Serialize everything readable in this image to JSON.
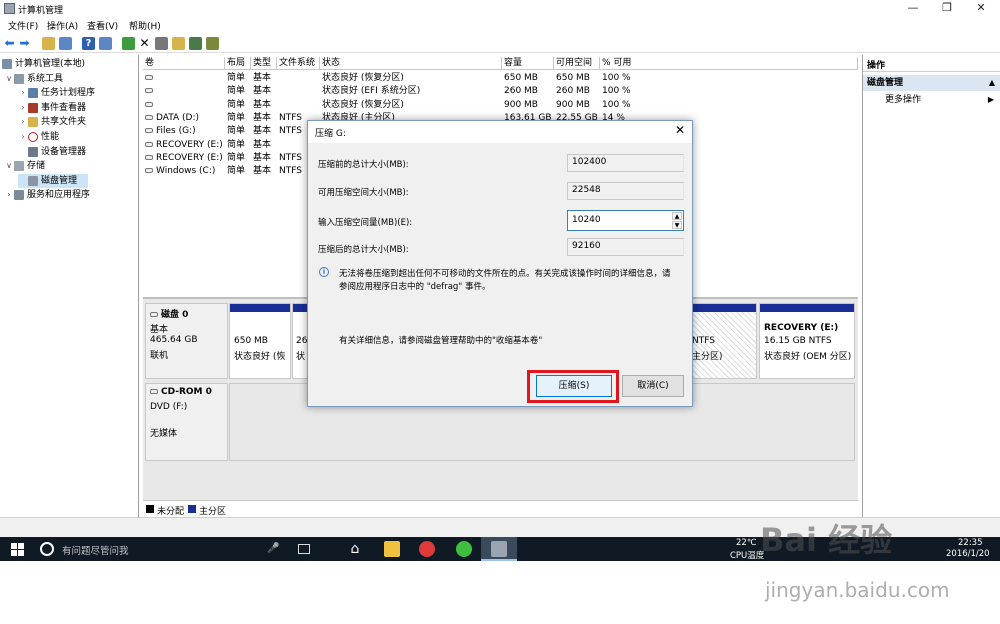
{
  "window": {
    "title": "计算机管理"
  },
  "menu": [
    "文件(F)",
    "操作(A)",
    "查看(V)",
    "帮助(H)"
  ],
  "tree": {
    "root": "计算机管理(本地)",
    "system_tools": "系统工具",
    "task_scheduler": "任务计划程序",
    "event_viewer": "事件查看器",
    "shared_folders": "共享文件夹",
    "performance": "性能",
    "device_manager": "设备管理器",
    "storage": "存储",
    "disk_management": "磁盘管理",
    "services_apps": "服务和应用程序"
  },
  "volume_table": {
    "headers": [
      "卷",
      "布局",
      "类型",
      "文件系统",
      "状态",
      "容量",
      "可用空间",
      "% 可用"
    ],
    "rows": [
      [
        "",
        "简单",
        "基本",
        "",
        "状态良好 (恢复分区)",
        "650 MB",
        "650 MB",
        "100 %"
      ],
      [
        "",
        "简单",
        "基本",
        "",
        "状态良好 (EFI 系统分区)",
        "260 MB",
        "260 MB",
        "100 %"
      ],
      [
        "",
        "简单",
        "基本",
        "",
        "状态良好 (恢复分区)",
        "900 MB",
        "900 MB",
        "100 %"
      ],
      [
        "DATA (D:)",
        "简单",
        "基本",
        "NTFS",
        "状态良好 (主分区)",
        "163.61 GB",
        "22.55 GB",
        "14 %"
      ],
      [
        "Files (G:)",
        "简单",
        "基本",
        "NTFS",
        "",
        "",
        "",
        ""
      ],
      [
        "RECOVERY (E:)",
        "简单",
        "基本",
        "",
        "",
        "",
        "",
        ""
      ],
      [
        "RECOVERY (E:)",
        "简单",
        "基本",
        "NTFS",
        "",
        "",
        "",
        ""
      ],
      [
        "Windows (C:)",
        "简单",
        "基本",
        "NTFS",
        "",
        "",
        "",
        ""
      ]
    ]
  },
  "disk0": {
    "name": "磁盘 0",
    "type": "基本",
    "size": "465.64 GB",
    "status": "联机",
    "part1_size": "650 MB",
    "part1_status": "状态良好 (恢",
    "part2_size": "26",
    "part2_status": "状",
    "part3_fs": "NTFS",
    "part3_status": "主分区)",
    "recovery_title": "RECOVERY  (E:)",
    "recovery_size": "16.15 GB NTFS",
    "recovery_status": "状态良好 (OEM 分区)"
  },
  "cdrom0": {
    "name": "CD-ROM 0",
    "drive": "DVD (F:)",
    "media": "无媒体"
  },
  "legend": {
    "unallocated": "未分配",
    "primary": "主分区"
  },
  "actions": {
    "header": "操作",
    "section": "磁盘管理",
    "more": "更多操作"
  },
  "dialog": {
    "title": "压缩 G:",
    "total_before_label": "压缩前的总计大小(MB):",
    "total_before_value": "102400",
    "available_label": "可用压缩空间大小(MB):",
    "available_value": "22548",
    "input_label": "输入压缩空间量(MB)(E):",
    "input_value": "10240",
    "total_after_label": "压缩后的总计大小(MB):",
    "total_after_value": "92160",
    "info_text_1": "无法将卷压缩到超出任何不可移动的文件所在的点。有关完成该操作时间的详细信息，请",
    "info_text_2": "参阅应用程序日志中的 \"defrag\" 事件。",
    "help_text": "有关详细信息，请参阅磁盘管理帮助中的\"收缩基本卷\"",
    "shrink_button": "压缩(S)",
    "cancel_button": "取消(C)",
    "highlight_color": "#e0161c"
  },
  "taskbar": {
    "search": "有问题尽管问我",
    "temp": "22℃",
    "cpu": "CPU温度",
    "time": "22:35",
    "date": "2016/1/20"
  },
  "watermark": {
    "brand": "Bai  经验",
    "url": "jingyan.baidu.com"
  }
}
